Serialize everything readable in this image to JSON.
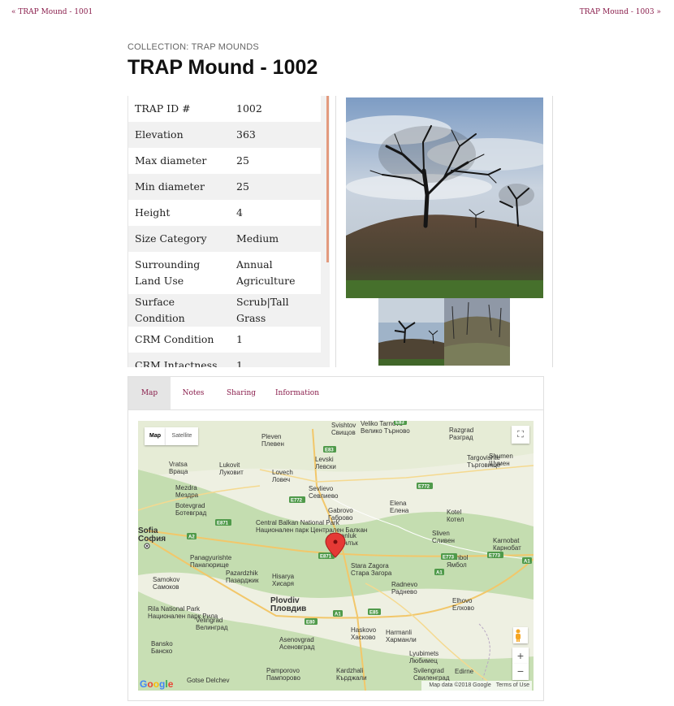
{
  "nav": {
    "prev_label": "« TRAP Mound - 1001",
    "next_label": "TRAP Mound - 1003 »"
  },
  "header": {
    "collection": "COLLECTION: TRAP MOUNDS",
    "title": "TRAP Mound - 1002"
  },
  "attributes": [
    {
      "key": "TRAP ID #",
      "value": "1002"
    },
    {
      "key": "Elevation",
      "value": "363"
    },
    {
      "key": "Max diameter",
      "value": "25"
    },
    {
      "key": "Min diameter",
      "value": "25"
    },
    {
      "key": "Height",
      "value": "4"
    },
    {
      "key": "Size Category",
      "value": "Medium"
    },
    {
      "key": "Surrounding Land Use",
      "value": "Annual Agriculture"
    },
    {
      "key": "Surface Condition",
      "value": "Scrub|Tall Grass"
    },
    {
      "key": "CRM Condition",
      "value": "1"
    },
    {
      "key": "CRM Intactness",
      "value": "1"
    }
  ],
  "tabs": [
    {
      "label": "Map"
    },
    {
      "label": "Notes"
    },
    {
      "label": "Sharing"
    },
    {
      "label": "Information"
    }
  ],
  "map": {
    "type_map": "Map",
    "type_satellite": "Satellite",
    "fullscreen_icon": "⛶",
    "zoom_in": "+",
    "zoom_out": "−",
    "attribution_data": "Map data ©2018 Google",
    "attribution_terms": "Terms of Use",
    "logo": "Google",
    "places": [
      {
        "name": "Svishtov",
        "alt": "Свищов"
      },
      {
        "name": "Pleven",
        "alt": "Плевен"
      },
      {
        "name": "Razgrad",
        "alt": "Разград"
      },
      {
        "name": "Shumen",
        "alt": "Шумен"
      },
      {
        "name": "Levski",
        "alt": "Левски"
      },
      {
        "name": "Veliko Tarnovo",
        "alt": "Велико Търново"
      },
      {
        "name": "Targovishte",
        "alt": "Търговище"
      },
      {
        "name": "Vratsa",
        "alt": "Враца"
      },
      {
        "name": "Lukovit",
        "alt": "Луковит"
      },
      {
        "name": "Lovech",
        "alt": "Ловеч"
      },
      {
        "name": "Sevlievo",
        "alt": "Севлиево"
      },
      {
        "name": "Mezdra",
        "alt": "Мездра"
      },
      {
        "name": "Botevgrad",
        "alt": "Ботевград"
      },
      {
        "name": "Gabrovo",
        "alt": "Габрово"
      },
      {
        "name": "Elena",
        "alt": "Елена"
      },
      {
        "name": "Kotel",
        "alt": "Котел"
      },
      {
        "name": "Sofia",
        "alt": "София"
      },
      {
        "name": "Central Balkan National Park",
        "alt": "Национален парк Централен Балкан"
      },
      {
        "name": "Kazanluk",
        "alt": "Казанлък"
      },
      {
        "name": "Sliven",
        "alt": "Сливен"
      },
      {
        "name": "Karnobat",
        "alt": "Карнобат"
      },
      {
        "name": "Panagyurishte",
        "alt": "Панагюрище"
      },
      {
        "name": "Hisarya",
        "alt": "Хисаря"
      },
      {
        "name": "Stara Zagora",
        "alt": "Стара Загора"
      },
      {
        "name": "Yambol",
        "alt": "Ямбол"
      },
      {
        "name": "Samokov",
        "alt": "Самоков"
      },
      {
        "name": "Pazardzhik",
        "alt": "Пазарджик"
      },
      {
        "name": "Plovdiv",
        "alt": "Пловдив"
      },
      {
        "name": "Radnevo",
        "alt": "Раднево"
      },
      {
        "name": "Rila National Park",
        "alt": "Национален парк Рила"
      },
      {
        "name": "Velingrad",
        "alt": "Велинград"
      },
      {
        "name": "Haskovo",
        "alt": "Хасково"
      },
      {
        "name": "Harmanli",
        "alt": "Харманли"
      },
      {
        "name": "Elhovo",
        "alt": "Елхово"
      },
      {
        "name": "Asenovgrad",
        "alt": "Асеновград"
      },
      {
        "name": "Bansko",
        "alt": "Банско"
      },
      {
        "name": "Lyubimets",
        "alt": "Любимец"
      },
      {
        "name": "Pamporovo",
        "alt": "Пампорово"
      },
      {
        "name": "Kardzhali",
        "alt": "Кърджали"
      },
      {
        "name": "Svilengrad",
        "alt": "Свиленград"
      },
      {
        "name": "Edirne",
        "alt": ""
      },
      {
        "name": "Gotse Delchev",
        "alt": ""
      }
    ],
    "roads": [
      "E83",
      "E83",
      "E772",
      "E772",
      "E871",
      "A2",
      "E871",
      "E773",
      "E773",
      "A1",
      "A1",
      "E85",
      "E80",
      "A1"
    ]
  },
  "colors": {
    "link": "#8a1e4c",
    "scroll_thumb": "#e39a7e",
    "marker": "#e53935"
  }
}
